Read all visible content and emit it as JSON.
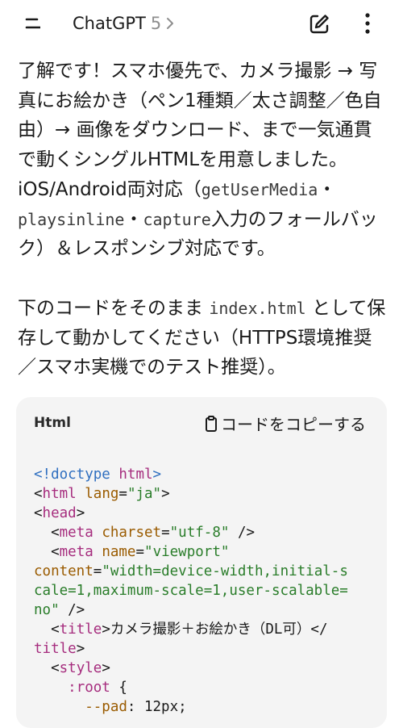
{
  "header": {
    "app_title": "ChatGPT",
    "version": "5",
    "menu_icon": "menu-icon",
    "edit_icon": "new-chat-icon",
    "more_icon": "more-vertical-icon"
  },
  "message": {
    "p1_a": "了解です！スマホ優先で、カメラ撮影 → 写真にお絵かき（ペン1種類／太さ調整／色自由）→ 画像をダウンロード、まで一気通貫で動くシングルHTMLを用意しました。iOS/Android両対応（",
    "code1": "getUserMedia",
    "p1_b": "・",
    "code2": "playsinline",
    "p1_c": "・",
    "code3": "capture",
    "p1_d": "入力のフォールバック）＆レスポンシブ対応です。",
    "p2_a": "下のコードをそのまま",
    "code4": "index.html",
    "p2_b": "として保存して動かしてください（HTTPS環境推奨／スマホ実機でのテスト推奨）。"
  },
  "codeblock": {
    "language": "Html",
    "copy_label": "コードをコピーする",
    "lines": {
      "l1_doctype": "<!doctype",
      "l1_html": "html",
      "l1_end": ">",
      "l2_open": "<",
      "l2_tag": "html",
      "l2_attr": "lang",
      "l2_eq": "=",
      "l2_val": "\"ja\"",
      "l2_close": ">",
      "l3_open": "<",
      "l3_tag": "head",
      "l3_close": ">",
      "l4_open": "<",
      "l4_tag": "meta",
      "l4_attr": "charset",
      "l4_eq": "=",
      "l4_val": "\"utf-8\"",
      "l4_close": " />",
      "l5_open": "<",
      "l5_tag": "meta",
      "l5_attr": "name",
      "l5_eq": "=",
      "l5_val": "\"viewport\"",
      "l6_attr": "content",
      "l6_eq": "=",
      "l6_val": "\"width=device-width,initial-s",
      "l7_val": "cale=1,maximum-scale=1,user-scalable=",
      "l8_val": "no\"",
      "l8_close": " />",
      "l9_open": "<",
      "l9_tag": "title",
      "l9_close": ">",
      "l9_text": "カメラ撮影＋お絵かき（DL可）</",
      "l10_tag": "title",
      "l10_close": ">",
      "l11_open": "<",
      "l11_tag": "style",
      "l11_close": ">",
      "l12_sel": ":root",
      "l12_brace": " {",
      "l13_var": "--pad",
      "l13_rest": ": 12px;"
    }
  }
}
